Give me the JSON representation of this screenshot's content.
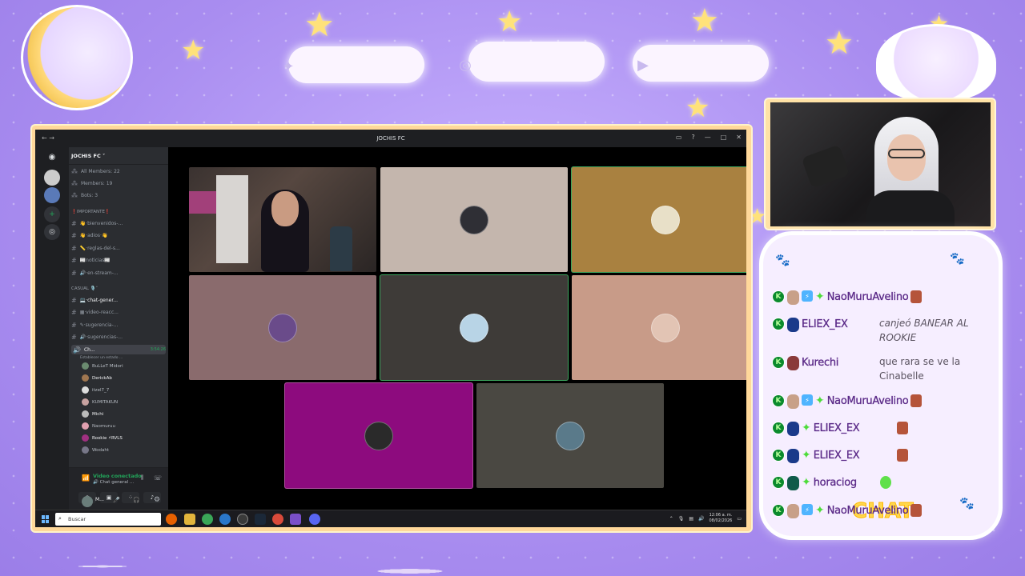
{
  "overlay": {
    "chat_title": "CHAT",
    "social_icons": [
      "twitter-icon",
      "instagram-icon",
      "youtube-icon"
    ]
  },
  "window": {
    "title": "JOCHIS FC"
  },
  "server": {
    "name": "JOCHIS FC ˅",
    "stats": [
      {
        "icon": "⁂",
        "label": "All Members: 22"
      },
      {
        "icon": "⁂",
        "label": "Members: 19"
      },
      {
        "icon": "⁂",
        "label": "Bots: 3"
      }
    ],
    "categories": [
      {
        "label": "❗IMPORTANTE❗"
      },
      {
        "label": "CASUAL 🎙️˅"
      }
    ],
    "important_channels": [
      "👋·bienvenidos-...",
      "👋·adios·👋",
      "📏·reglas-del-s...",
      "📰noticias📰",
      "🔊·en-stream-..."
    ],
    "casual_channels": [
      "💻·chat-gener...",
      "▦·video-reacc...",
      "✎·sugerencia-...",
      "🔊·sugerencias-..."
    ],
    "voice_channel": {
      "name": "Ch...",
      "time": "3:54:26",
      "status": "Establecer un estado ..."
    },
    "voice_members": [
      "BuLLeT Midori",
      "DerickAb",
      "itzel7_7",
      "KUMITAKUN",
      "Michi",
      "Naomuruu",
      "Rookie ⚡RVLS",
      "Wodaht"
    ]
  },
  "voice_panel": {
    "title": "Video conectado",
    "subtitle": "🔊 Chat general ..."
  },
  "user_panel": {
    "name": "M..."
  },
  "taskbar": {
    "search_placeholder": "Buscar",
    "time": "12:06 a. m.",
    "date": "08/02/2026"
  },
  "chat": [
    {
      "user": "NaoMuruAvelino",
      "text": ""
    },
    {
      "user": "ELIEX_EX",
      "text": "canjeó BANEAR AL ROOKIE"
    },
    {
      "user": "Kurechi",
      "text": "que rara se ve la Cinabelle"
    },
    {
      "user": "NaoMuruAvelino",
      "text": ""
    },
    {
      "user": "ELIEX_EX",
      "text": ""
    },
    {
      "user": "ELIEX_EX",
      "text": ""
    },
    {
      "user": "horaciog",
      "text": ""
    },
    {
      "user": "NaoMuruAvelino",
      "text": ""
    }
  ],
  "colors": {
    "accent": "#5865f2",
    "overlay_bg": "#a98df0",
    "chat_title": "#ffd84d",
    "kick_green": "#0b8a2d"
  }
}
